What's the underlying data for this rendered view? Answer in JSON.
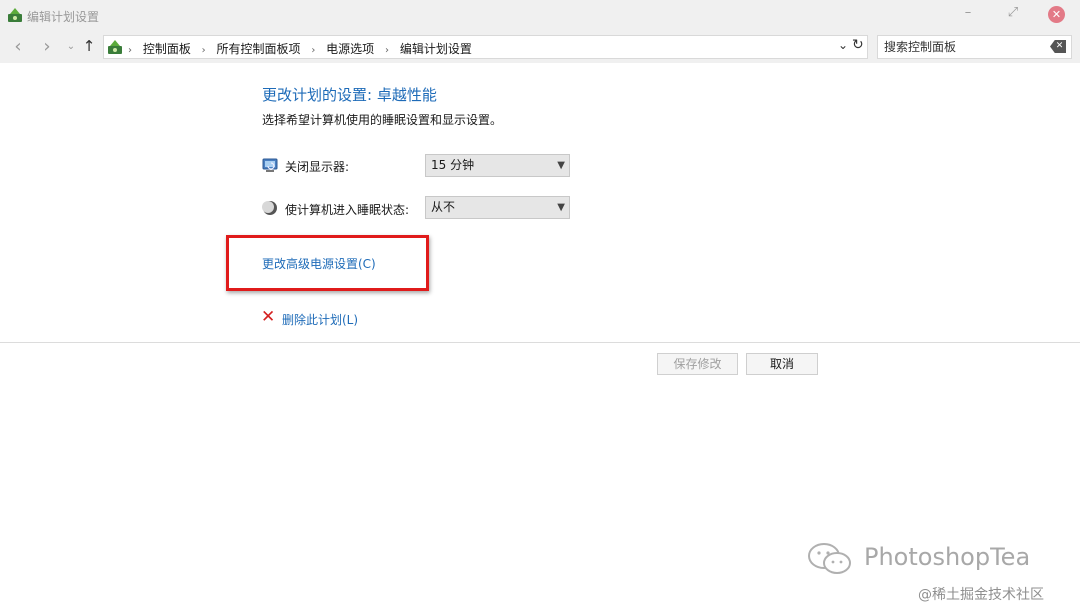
{
  "window": {
    "title": "编辑计划设置",
    "app_icon": "power-options-icon",
    "controls": {
      "minimize": "–",
      "maximize": "⤢",
      "close": "✕"
    }
  },
  "address_bar": {
    "back_icon": "‹",
    "forward_icon": "›",
    "up_icon": "↑",
    "breadcrumbs": [
      "控制面板",
      "所有控制面板项",
      "电源选项",
      "编辑计划设置"
    ],
    "separator": "›",
    "dropdown_icon": "⌄",
    "refresh_icon": "↻",
    "search_placeholder": "搜索控制面板"
  },
  "content": {
    "heading": "更改计划的设置: 卓越性能",
    "subtitle": "选择希望计算机使用的睡眠设置和显示设置。",
    "settings": [
      {
        "label": "关闭显示器:",
        "value": "15 分钟",
        "icon": "monitor-icon"
      },
      {
        "label": "使计算机进入睡眠状态:",
        "value": "从不",
        "icon": "sleep-moon-icon"
      }
    ],
    "advanced_link": "更改高级电源设置(C)",
    "delete_link": "删除此计划(L)",
    "highlight_color": "#e01b1b",
    "link_color": "#1e6bb8"
  },
  "buttons": {
    "save": "保存修改",
    "cancel": "取消"
  },
  "watermark": {
    "brand": "PhotoshopTea",
    "site": "@稀土掘金技术社区"
  }
}
